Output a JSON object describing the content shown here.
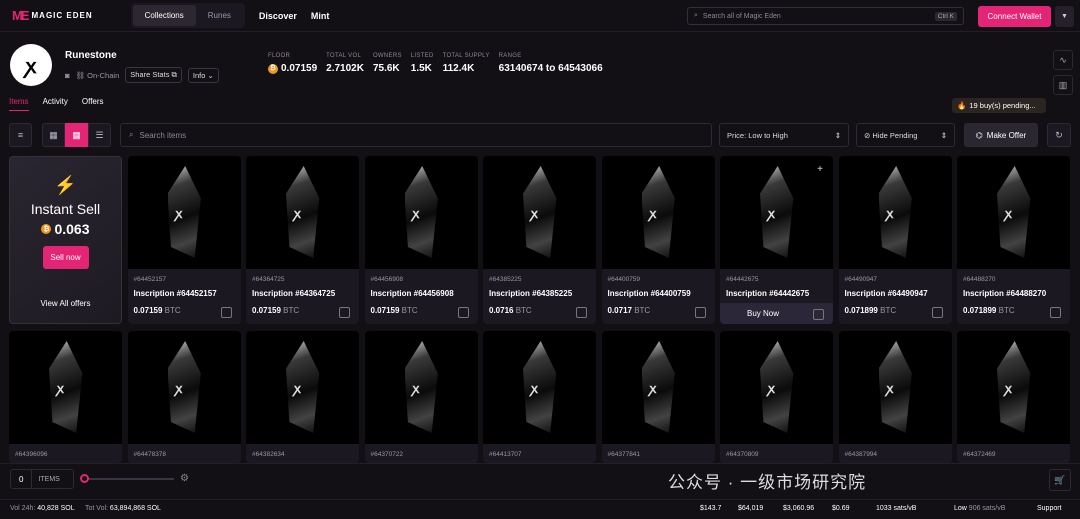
{
  "nav": {
    "logo_text": "MAGIC EDEN",
    "tabs": [
      "Collections",
      "Runes"
    ],
    "links": [
      "Discover",
      "Mint"
    ],
    "search_placeholder": "Search all of Magic Eden",
    "search_shortcut": "Ctrl K",
    "connect_label": "Connect Wallet"
  },
  "collection": {
    "name": "Runestone",
    "onchain": "On-Chain",
    "share_label": "Share Stats",
    "info_label": "Info",
    "stats": [
      {
        "label": "FLOOR",
        "value": "0.07159",
        "btc": true
      },
      {
        "label": "TOTAL VOL",
        "value": "2.7102K",
        "btc": false
      },
      {
        "label": "OWNERS",
        "value": "75.6K",
        "btc": false
      },
      {
        "label": "LISTED",
        "value": "1.5K",
        "btc": false
      },
      {
        "label": "TOTAL SUPPLY",
        "value": "112.4K",
        "btc": false
      },
      {
        "label": "RANGE",
        "value": "63140674 to 64543066",
        "btc": false
      }
    ]
  },
  "subtabs": [
    "Items",
    "Activity",
    "Offers"
  ],
  "pending_label": "19 buy(s) pending...",
  "toolbar": {
    "search_placeholder": "Search items",
    "sort_label": "Price: Low to High",
    "pending_filter": "Hide Pending",
    "offer_label": "Make Offer"
  },
  "instant_sell": {
    "title": "Instant Sell",
    "value": "0.063",
    "button": "Sell now",
    "view_all": "View All offers"
  },
  "cards_row1": [
    {
      "num": "#64452157",
      "name": "Inscription #64452157",
      "price": "0.07159",
      "unit": "BTC"
    },
    {
      "num": "#64364725",
      "name": "Inscription #64364725",
      "price": "0.07159",
      "unit": "BTC"
    },
    {
      "num": "#64456908",
      "name": "Inscription #64456908",
      "price": "0.07159",
      "unit": "BTC"
    },
    {
      "num": "#64385225",
      "name": "Inscription #64385225",
      "price": "0.0716",
      "unit": "BTC"
    },
    {
      "num": "#64400759",
      "name": "Inscription #64400759",
      "price": "0.0717",
      "unit": "BTC"
    },
    {
      "num": "#64442675",
      "name": "Inscription #64442675",
      "price": "",
      "unit": "",
      "buy_now": "Buy Now"
    },
    {
      "num": "#64490947",
      "name": "Inscription #64490947",
      "price": "0.071899",
      "unit": "BTC"
    },
    {
      "num": "#64488270",
      "name": "Inscription #64488270",
      "price": "0.071899",
      "unit": "BTC"
    }
  ],
  "cards_row2": [
    "#64396096",
    "#64478378",
    "#64382634",
    "#64370722",
    "#64413707",
    "#64377841",
    "#64370809",
    "#64387994",
    "#64372469"
  ],
  "bottom": {
    "qty": "0",
    "items_label": "ITEMS"
  },
  "footer": {
    "vol24_label": "Vol 24h:",
    "vol24": "40,828 SOL",
    "totvol_label": "Tot Vol:",
    "totvol": "63,894,868 SOL",
    "prices": [
      "$143.7",
      "$64,019",
      "$3,060.96",
      "$0.69"
    ],
    "sats": "1033 sats/vB",
    "low_label": "Low",
    "low_val": "906 sats/vB",
    "support": "Support"
  },
  "watermark": "公众号 · 一级市场研究院"
}
